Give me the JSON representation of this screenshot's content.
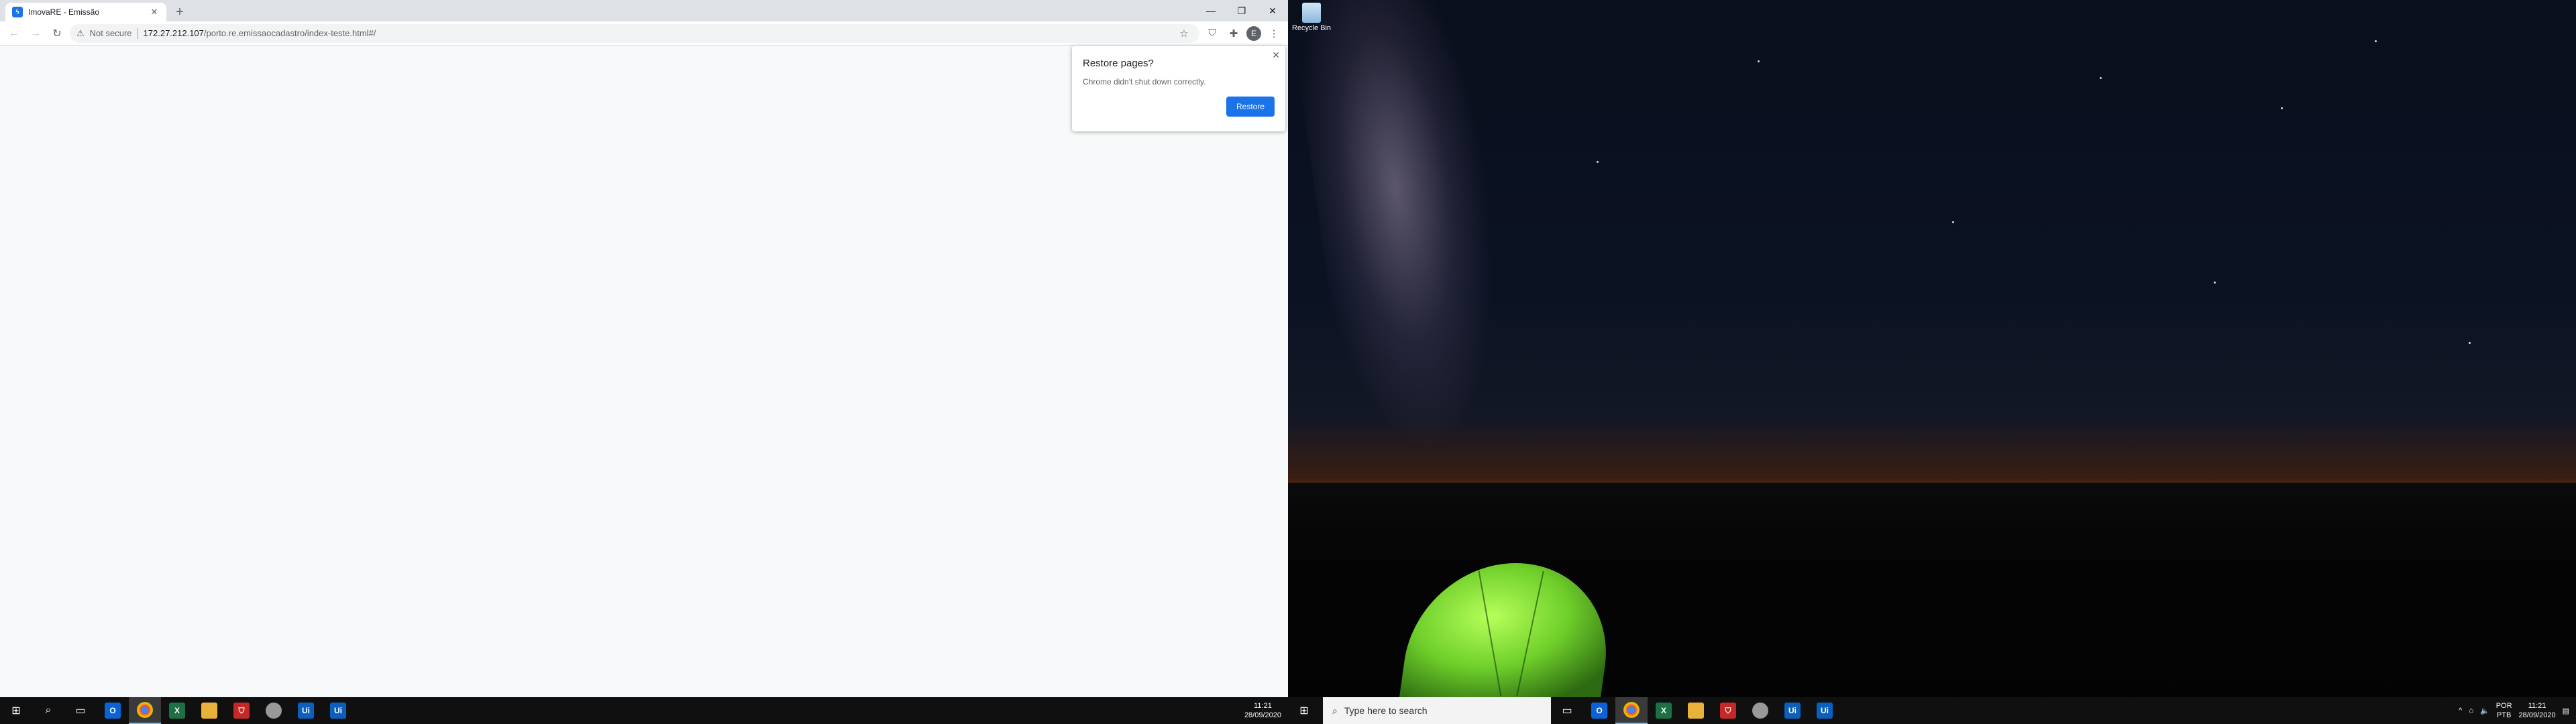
{
  "browser": {
    "tab_title": "ImovaRE - Emissão",
    "url_host": "172.27.212.107",
    "url_path": "/porto.re.emissaocadastro/index-teste.html#/",
    "security_label": "Not secure",
    "profile_initial": "E"
  },
  "restore_bubble": {
    "title": "Restore pages?",
    "body": "Chrome didn't shut down correctly.",
    "button": "Restore"
  },
  "desktop": {
    "recycle_bin_label": "Recycle Bin"
  },
  "taskbar_left": {
    "time": "11:21",
    "date": "28/09/2020"
  },
  "taskbar_right": {
    "search_placeholder": "Type here to search",
    "lang_line1": "POR",
    "lang_line2": "PTB",
    "time": "11:21",
    "date": "28/09/2020"
  }
}
